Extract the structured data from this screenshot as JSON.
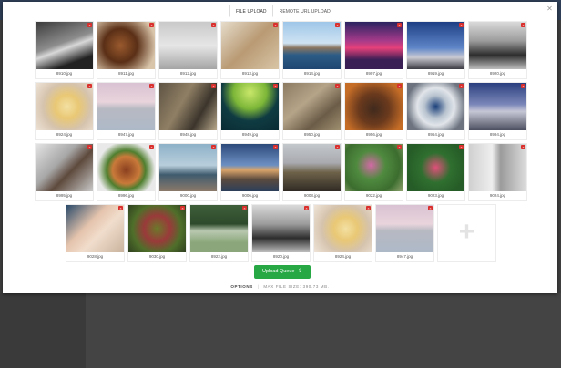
{
  "tabs": [
    {
      "label": "FILE UPLOAD",
      "active": true
    },
    {
      "label": "REMOTE URL UPLOAD",
      "active": false
    }
  ],
  "files": [
    {
      "name": "8910.jpg",
      "bg": "linear-gradient(160deg,#3b3b3b,#8d8d8d 45%,#d8d8d8 55%,#222 80%)"
    },
    {
      "name": "8911.jpg",
      "bg": "radial-gradient(circle at 40% 50%,#9a5a2e,#5a2f16 40%,#d9c5aa 85%)"
    },
    {
      "name": "8912.jpg",
      "bg": "linear-gradient(180deg,#c9c9c9,#e6e6e6 50%,#a5a5a5)"
    },
    {
      "name": "8913.jpg",
      "bg": "linear-gradient(135deg,#e6dccb,#b99a74 50%,#d8c5a6)"
    },
    {
      "name": "8914.jpg",
      "bg": "linear-gradient(180deg,#9fc6e8 0%,#cfe3f3 45%,#8a7560 55%,#2c5c86 70%,#1f4670)"
    },
    {
      "name": "8907.jpg",
      "bg": "linear-gradient(180deg,#2b2360 0%,#a63a8a 40%,#e6407a 55%,#3a1f55 80%)"
    },
    {
      "name": "8919.jpg",
      "bg": "linear-gradient(180deg,#1e3f84 0%,#5f86c8 55%,#c9c9d2 75%,#3d3c44)"
    },
    {
      "name": "8920.jpg",
      "bg": "linear-gradient(180deg,#d9d9d9,#9c9c9c 40%,#2d2d2d 70%,#bdbdbd)"
    },
    {
      "name": "8924.jpg",
      "bg": "radial-gradient(circle at 55% 50%,#f3e0a3,#e9c875 30%,#d5c3ad 60%,#efe4d8)"
    },
    {
      "name": "8947.jpg",
      "bg": "linear-gradient(180deg,#d9c2d2 0%,#e9d4dc 40%,#b7b9c2 55%,#aeb9c8 100%)"
    },
    {
      "name": "8948.jpg",
      "bg": "linear-gradient(120deg,#5f5444,#8f7f64 40%,#3c352c 70%,#b8a88b)"
    },
    {
      "name": "8949.jpg",
      "bg": "radial-gradient(circle at 50% 20%,#c9e76a,#7cb638 35%,#0f3b42 60%,#0a2b33)"
    },
    {
      "name": "8950.jpg",
      "bg": "linear-gradient(140deg,#8c7b62,#b5a488 40%,#6b5c48 70%,#a09070)"
    },
    {
      "name": "8956.jpg",
      "bg": "radial-gradient(circle at 50% 55%,#402a1d,#6b3a1d 40%,#c56d27 80%)"
    },
    {
      "name": "8964.jpg",
      "bg": "radial-gradient(circle at 50% 50%,#1a3f7a,#b8c3cf 30%,#e1e5ea 50%,#6d7480 80%)"
    },
    {
      "name": "8994.jpg",
      "bg": "linear-gradient(180deg,#2b3f7f 0%,#7a86b8 45%,#c6c7d6 60%,#4c4f5f)"
    },
    {
      "name": "8995.jpg",
      "bg": "linear-gradient(135deg,#e4e4e4,#a7a7a7 40%,#5e4a3d 60%,#c9c9c9)"
    },
    {
      "name": "8996.jpg",
      "bg": "radial-gradient(circle at 50% 55%,#8a3f1f,#c97a3a 35%,#4f7f2f 50%,#e9e9e9 75%)"
    },
    {
      "name": "9000.jpg",
      "bg": "linear-gradient(180deg,#8eb1c8 0%,#b8cedc 45%,#3f5b6e 65%,#8b7a6a)"
    },
    {
      "name": "9006.jpg",
      "bg": "linear-gradient(180deg,#2c4a7a 0%,#6d90c2 45%,#d9a46a 55%,#5a4a3e 75%,#2c3f5a)"
    },
    {
      "name": "9008.jpg",
      "bg": "linear-gradient(180deg,#c3c8cc 0%,#a9aab0 40%,#6e6249 60%,#2f2a24)"
    },
    {
      "name": "9022.jpg",
      "bg": "radial-gradient(circle at 45% 45%,#d26aa5,#4f8a3f 35%,#3c6d2f 70%,#8fa36e)"
    },
    {
      "name": "9023.jpg",
      "bg": "radial-gradient(circle at 50% 50%,#e0507a,#2f6f2f 40%,#265c27 80%)"
    },
    {
      "name": "9024.jpg",
      "bg": "linear-gradient(90deg,#d0d0d0,#eeeeee 40%,#9b9b9b 55%,#dcdcdc)"
    },
    {
      "name": "9028.jpg",
      "bg": "linear-gradient(135deg,#2a4a6a,#e5c4ad 40%,#f1ddcc 60%,#c9b39e)"
    },
    {
      "name": "9030.jpg",
      "bg": "radial-gradient(circle at 50% 50%,#6a7a2a,#9a3a3a 35%,#4f6f2a 65%,#2f3f1f)"
    },
    {
      "name": "8922.jpg",
      "bg": "linear-gradient(180deg,#3f5f3a 0%,#2d4a2a 40%,#b8c8b0 55%,#8aa67a 80%)"
    },
    {
      "name": "8920.jpg",
      "bg": "linear-gradient(180deg,#d9d9d9,#9c9c9c 40%,#2d2d2d 70%,#bdbdbd)"
    },
    {
      "name": "8924.jpg",
      "bg": "radial-gradient(circle at 55% 50%,#f3e0a3,#e9c875 30%,#d5c3ad 60%,#efe4d8)"
    },
    {
      "name": "8947.jpg",
      "bg": "linear-gradient(180deg,#d9c2d2 0%,#e9d4dc 40%,#b7b9c2 55%,#aeb9c8 100%)"
    }
  ],
  "upload_button": "Upload Queue",
  "options_label": "OPTIONS",
  "max_file_size": "MAX FILE SIZE: 390.73 MB."
}
